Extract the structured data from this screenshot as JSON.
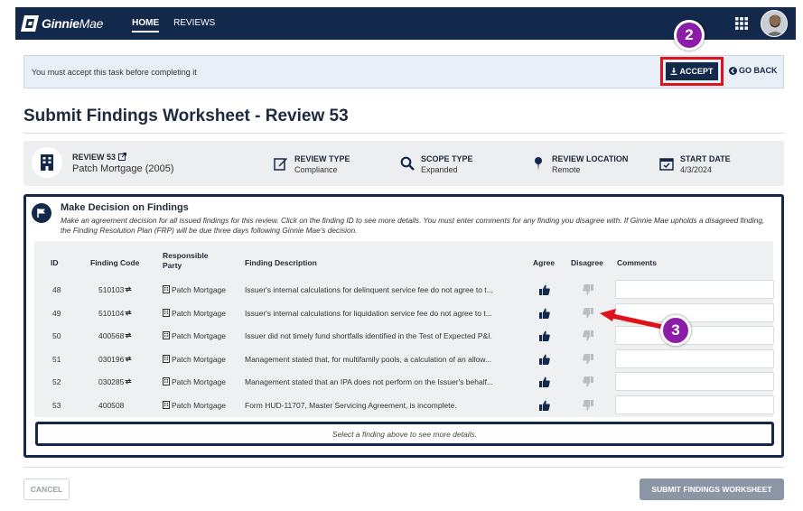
{
  "header": {
    "logo_text_bold": "Ginnie",
    "logo_text_light": "Mae",
    "nav": [
      {
        "label": "HOME",
        "active": true
      },
      {
        "label": "REVIEWS",
        "active": false
      }
    ],
    "icons": [
      "apps-grid-icon",
      "user-avatar"
    ]
  },
  "notice": {
    "message": "You must accept this task before completing it",
    "accept_label": "ACCEPT",
    "go_back_label": "GO BACK"
  },
  "page": {
    "title": "Submit Findings Worksheet - Review 53"
  },
  "review_info": {
    "review_label": "REVIEW 53",
    "review_value": "Patch Mortgage (2005)",
    "type_label": "REVIEW TYPE",
    "type_value": "Compliance",
    "scope_label": "SCOPE TYPE",
    "scope_value": "Expanded",
    "location_label": "REVIEW LOCATION",
    "location_value": "Remote",
    "start_label": "START DATE",
    "start_value": "4/3/2024"
  },
  "decision": {
    "title": "Make Decision on Findings",
    "description": "Make an agreement decision for all issued findings for this review. Click on the finding ID to see more details. You must enter comments for any finding you disagree with. If Ginnie Mae upholds a disagreed finding, the Finding Resolution Plan (FRP) will be due three days following Ginnie Mae's decision.",
    "columns": {
      "id": "ID",
      "code": "Finding Code",
      "party_line1": "Responsible",
      "party_line2": "Party",
      "description": "Finding Description",
      "agree": "Agree",
      "disagree": "Disagree",
      "comments": "Comments"
    },
    "rows": [
      {
        "id": "48",
        "code": "510103",
        "repeat": true,
        "party": "Patch Mortgage",
        "description": "Issuer's internal calculations for delinquent service fee do not agree to t..."
      },
      {
        "id": "49",
        "code": "510104",
        "repeat": true,
        "party": "Patch Mortgage",
        "description": "Issuer's internal calculations for liquidation service fee do not agree to t..."
      },
      {
        "id": "50",
        "code": "400568",
        "repeat": true,
        "party": "Patch Mortgage",
        "description": "Issuer did not timely fund shortfalls identified in the Test of Expected P&I."
      },
      {
        "id": "51",
        "code": "030196",
        "repeat": true,
        "party": "Patch Mortgage",
        "description": "Management stated that, for multifamily pools, a calculation of an allow..."
      },
      {
        "id": "52",
        "code": "030285",
        "repeat": true,
        "party": "Patch Mortgage",
        "description": "Management stated that an IPA does not perform on the Issuer's behalf..."
      },
      {
        "id": "53",
        "code": "400508",
        "repeat": false,
        "party": "Patch Mortgage",
        "description": "Form HUD-11707, Master Servicing Agreement, is incomplete."
      }
    ],
    "details_placeholder": "Select a finding above to see more details."
  },
  "footer": {
    "cancel_label": "CANCEL",
    "submit_label": "SUBMIT FINDINGS WORKSHEET"
  },
  "annotations": {
    "step2": "2",
    "step3": "3"
  },
  "colors": {
    "navy": "#13294b",
    "callout": "#8b1da8",
    "highlight": "#e0111b"
  }
}
